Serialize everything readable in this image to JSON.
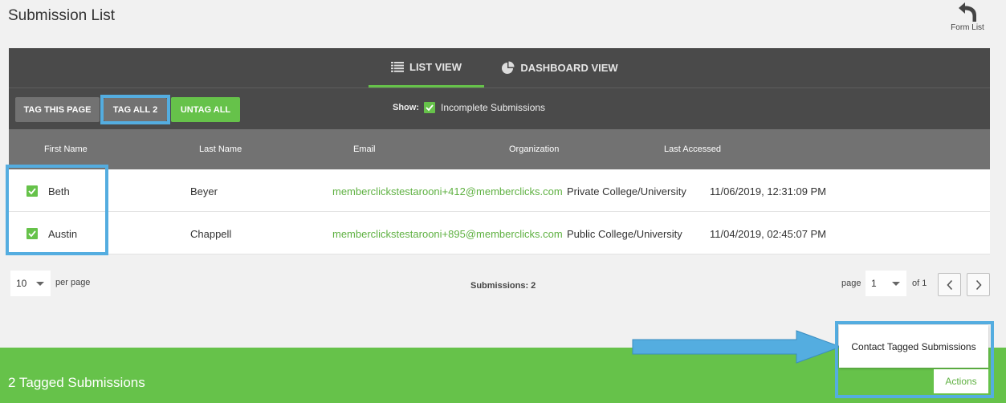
{
  "page_title": "Submission List",
  "form_list": {
    "label": "Form List",
    "icon": "undo-arrow-icon"
  },
  "view_tabs": [
    {
      "label": "LIST VIEW",
      "icon": "list-icon",
      "active": true
    },
    {
      "label": "DASHBOARD VIEW",
      "icon": "pie-chart-icon",
      "active": false
    }
  ],
  "toolbar": {
    "tag_this_page": "TAG THIS PAGE",
    "tag_all": "TAG ALL 2",
    "untag_all": "UNTAG ALL",
    "show_label": "Show:",
    "incomplete_label": "Incomplete Submissions",
    "incomplete_checked": true
  },
  "table": {
    "columns": [
      "First Name",
      "Last Name",
      "Email",
      "Organization",
      "Last Accessed"
    ],
    "rows": [
      {
        "checked": true,
        "first_name": "Beth",
        "last_name": "Beyer",
        "email": "memberclickstestarooni+412@memberclicks.com",
        "organization": "Private College/University",
        "last_accessed": "11/06/2019, 12:31:09 PM"
      },
      {
        "checked": true,
        "first_name": "Austin",
        "last_name": "Chappell",
        "email": "memberclickstestarooni+895@memberclicks.com",
        "organization": "Public College/University",
        "last_accessed": "11/04/2019, 02:45:07 PM"
      }
    ]
  },
  "pagination": {
    "per_page_value": "10",
    "per_page_label": "per page",
    "submissions_label": "Submissions: 2",
    "page_label": "page",
    "page_value": "1",
    "of_label": "of 1"
  },
  "footer": {
    "tagged_count": "2 Tagged Submissions",
    "contact_tagged": "Contact Tagged Submissions",
    "actions": "Actions"
  },
  "colors": {
    "accent_green": "#66c24a",
    "highlight_blue": "#54ade0",
    "dark_panel": "#4a4a4a",
    "header_gray": "#727272"
  }
}
